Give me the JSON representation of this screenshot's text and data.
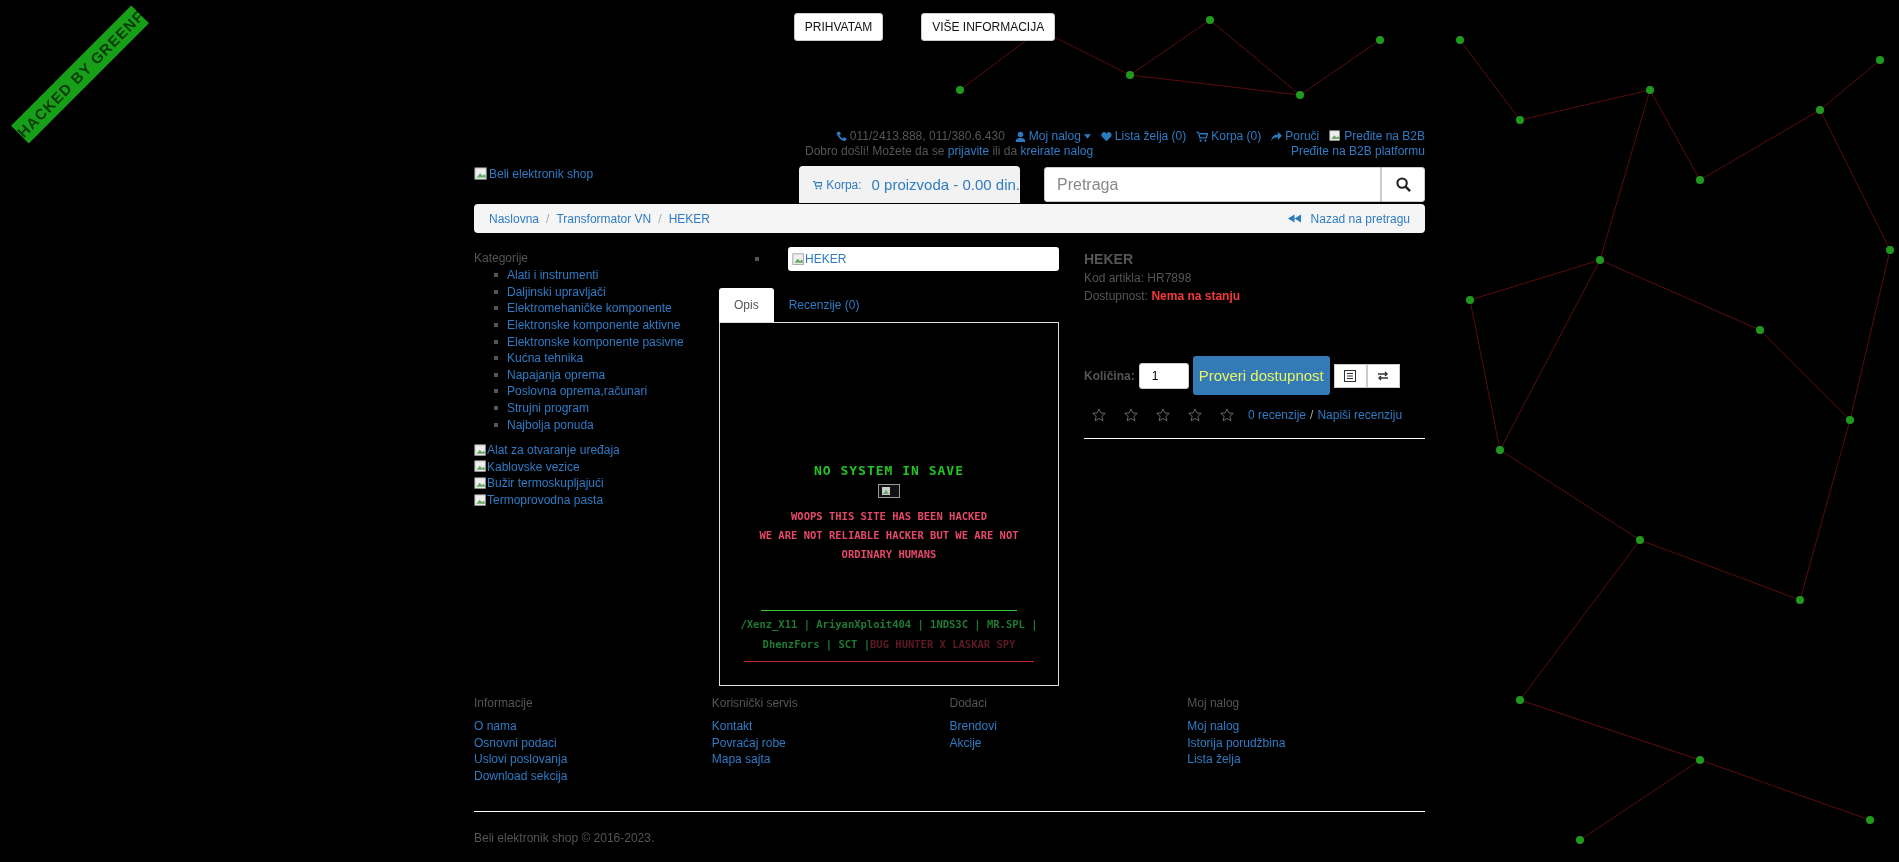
{
  "ribbon": {
    "text": "HACKED BY GREENF"
  },
  "cookie_bar": {
    "buttons": [
      "PRIHVATAM",
      "VIŠE INFORMACIJA"
    ]
  },
  "top_links": [
    {
      "kind": "phone",
      "label": "011/2413.888, 011/380.6.430"
    },
    {
      "kind": "account",
      "label": "Moj nalog"
    },
    {
      "kind": "heart",
      "label": "Lista želja (0)"
    },
    {
      "kind": "cart",
      "label": "Korpa (0)"
    },
    {
      "kind": "share",
      "label": "Poruči"
    },
    {
      "kind": "image",
      "label": "Pređite na B2B"
    }
  ],
  "b2b_link": "Pređite na B2B platformu",
  "welcome": {
    "text": "Dobro došli! Možete da se",
    "login": "prijavite",
    "middle": "ili da",
    "register": "kreirate nalog"
  },
  "logo_alt": "Beli elektronik shop",
  "cart": {
    "label": "Korpa:",
    "summary": "0 proizvoda - 0.00 din."
  },
  "search": {
    "placeholder": "Pretraga"
  },
  "breadcrumb": [
    "Naslovna",
    "Transformator VN",
    "HEKER"
  ],
  "breadcrumb_separator": "/",
  "back_link": "Nazad na pretragu",
  "sidebar": {
    "title": "Kategorije",
    "items": [
      "Alati i instrumenti",
      "Daljinski upravljači",
      "Elektromehaničke komponente",
      "Elektronske komponente aktivne",
      "Elektronske komponente pasivne",
      "Kućna tehnika",
      "Napajanja oprema",
      "Poslovna oprema,računari",
      "Strujni program",
      "Najbolja ponuda"
    ],
    "banners": [
      "Alat za otvaranje uređaja",
      "Kablovske vezice",
      "Bužir termoskupljajući",
      "Termoprovodna pasta"
    ]
  },
  "product_image_alt": "HEKER",
  "tabs": [
    {
      "label": "Opis",
      "selected": true
    },
    {
      "label": "Recenzije (0)",
      "selected": false
    }
  ],
  "description": {
    "title": "NO SYSTEM IN SAVE",
    "message": [
      "WOOPS THIS SITE HAS BEEN HACKED",
      "WE ARE NOT RELIABLE HACKER BUT WE ARE NOT",
      "ORDINARY HUMANS"
    ],
    "crew": [
      "/Xenz_X11 | AriyanXploit404 | 1NDS3C | MR.SPL |",
      "DhenzFors | SCT |"
    ],
    "crew_tail": "BUG HUNTER X LASKAR SPY"
  },
  "product": {
    "name": "HEKER",
    "code_label": "Kod artikla:",
    "code": "HR7898",
    "availability_label": "Dostupnost:",
    "availability": "Nema na stanju",
    "quantity_label": "Količina:",
    "quantity": "1",
    "check_button": "Proveri dostupnost",
    "stars": 0,
    "reviews": "0 recenzije",
    "review_separator": "/",
    "write_review": "Napiši recenziju"
  },
  "footer": {
    "columns": [
      {
        "title": "Informacije",
        "links": [
          "O nama",
          "Osnovni podaci",
          "Uslovi poslovanja",
          "Download sekcija"
        ]
      },
      {
        "title": "Korisnički servis",
        "links": [
          "Kontakt",
          "Povraćaj robe",
          "Mapa sajta"
        ]
      },
      {
        "title": "Dodaci",
        "links": [
          "Brendovi",
          "Akcije"
        ]
      },
      {
        "title": "Moj nalog",
        "links": [
          "Moj nalog",
          "Istorija porudžbina",
          "Lista želja"
        ]
      }
    ],
    "copyright": "Beli elektronik shop © 2016-2023."
  }
}
